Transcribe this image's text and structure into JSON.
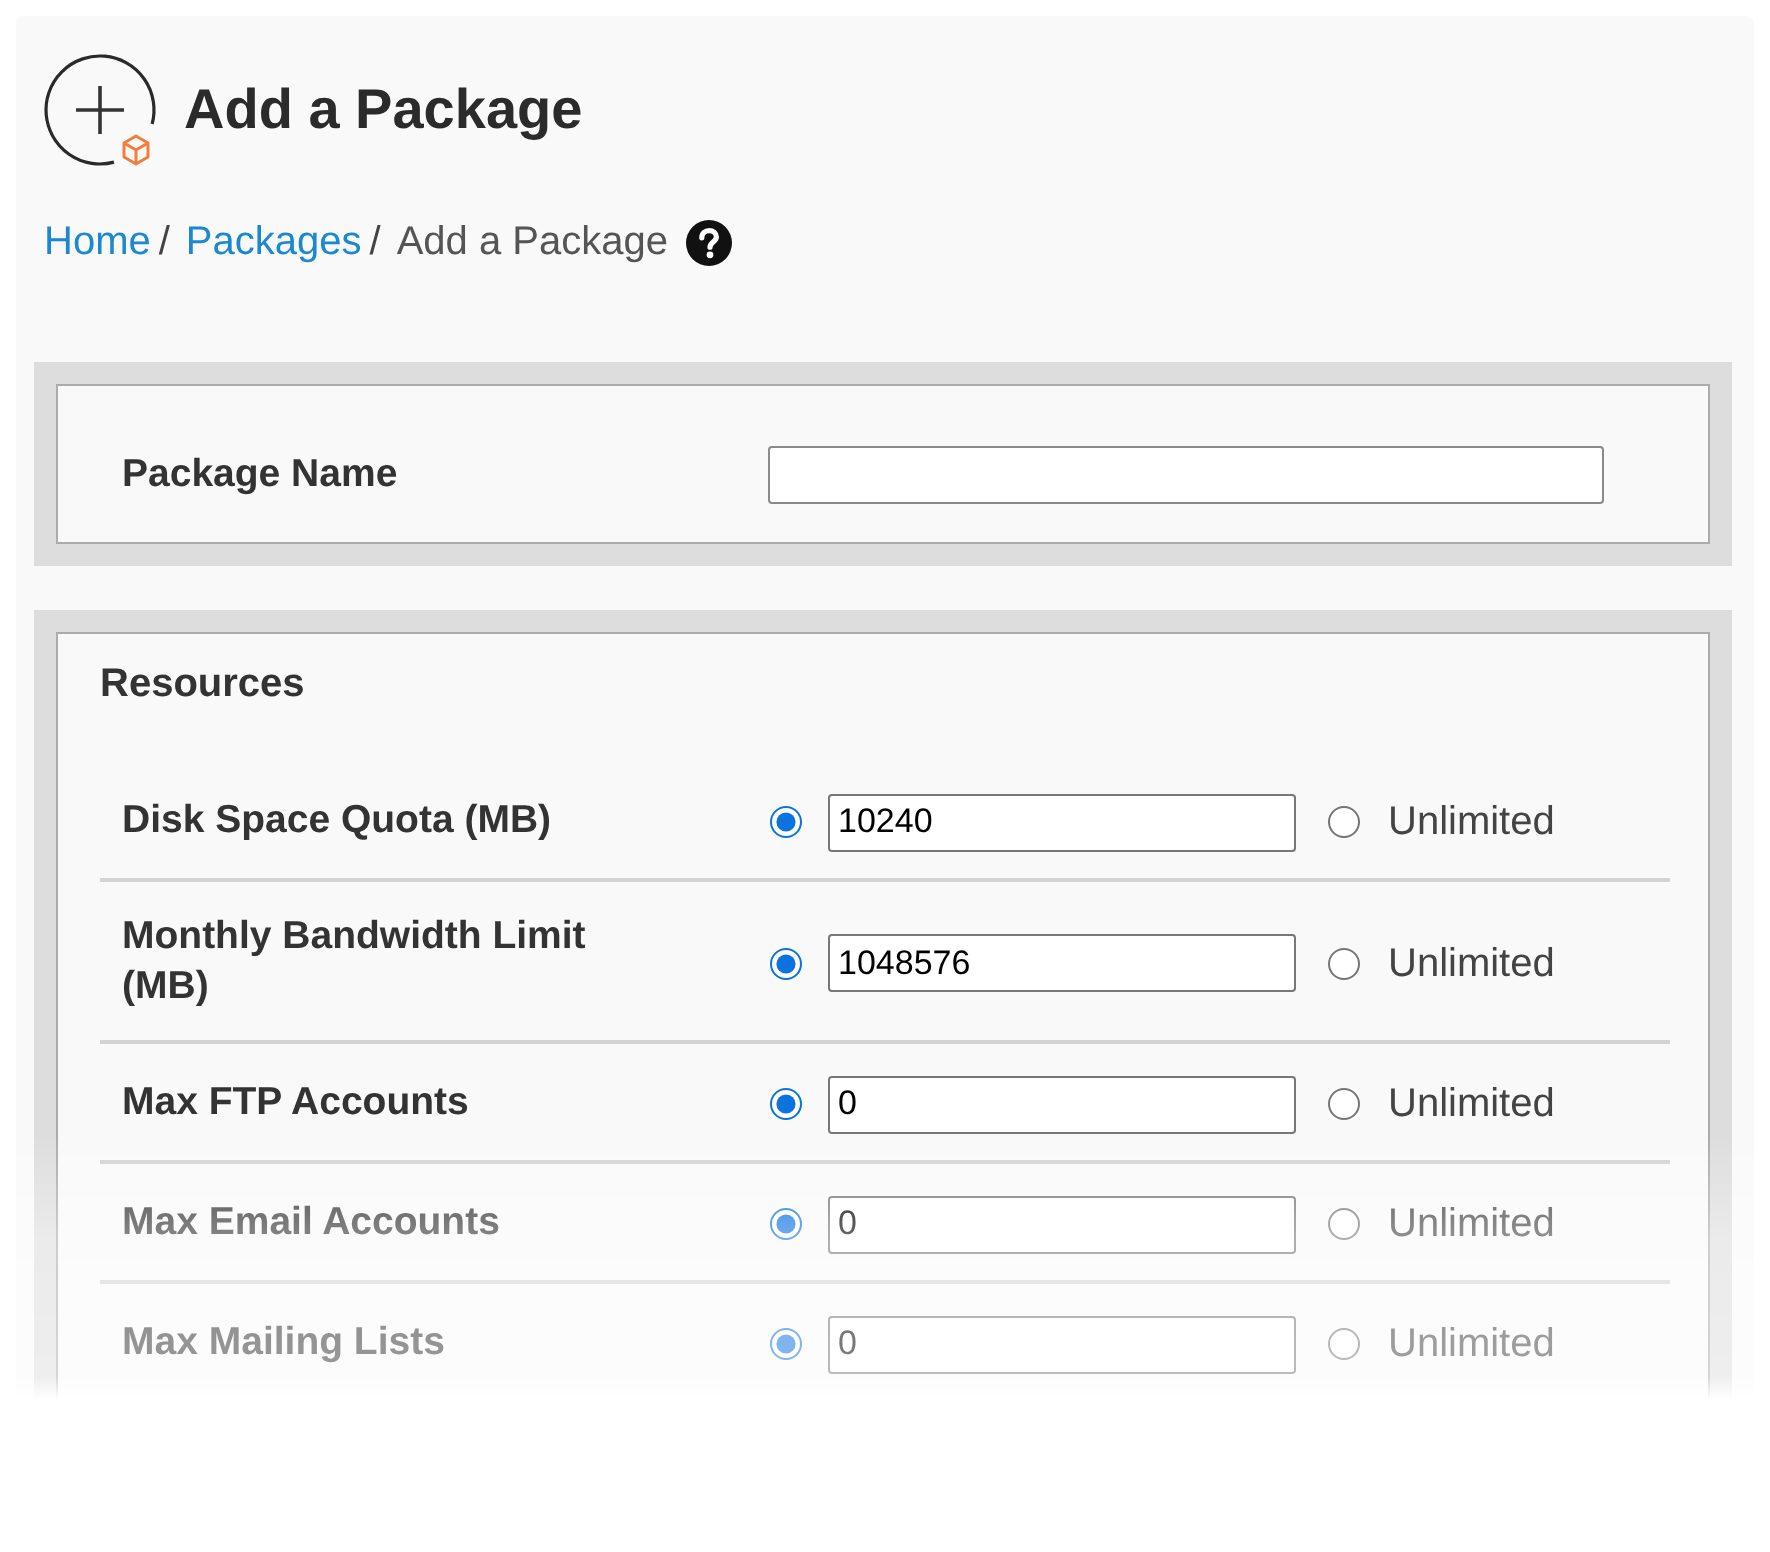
{
  "header": {
    "title": "Add a Package"
  },
  "breadcrumb": [
    {
      "label": "Home",
      "kind": "link",
      "separator": "/"
    },
    {
      "label": "Packages",
      "kind": "link",
      "separator": "/"
    },
    {
      "label": "Add a Package",
      "kind": "current"
    }
  ],
  "package_name": {
    "label": "Package Name"
  },
  "resources": {
    "title": "Resources",
    "rows": [
      {
        "label": "Disk Space Quota (MB)",
        "value": "10240",
        "unlimited": false,
        "unlimited_label": "Unlimited"
      },
      {
        "label": "Monthly Bandwidth Limit (MB)",
        "value": "1048576",
        "unlimited": false,
        "unlimited_label": "Unlimited"
      },
      {
        "label": "Max FTP Accounts",
        "value": "0",
        "unlimited": false,
        "unlimited_label": "Unlimited"
      },
      {
        "label": "Max Email Accounts",
        "value": "0",
        "unlimited": false,
        "unlimited_label": "Unlimited"
      },
      {
        "label": "Max Mailing Lists",
        "value": "0",
        "unlimited": false,
        "unlimited_label": "Unlimited"
      }
    ]
  }
}
